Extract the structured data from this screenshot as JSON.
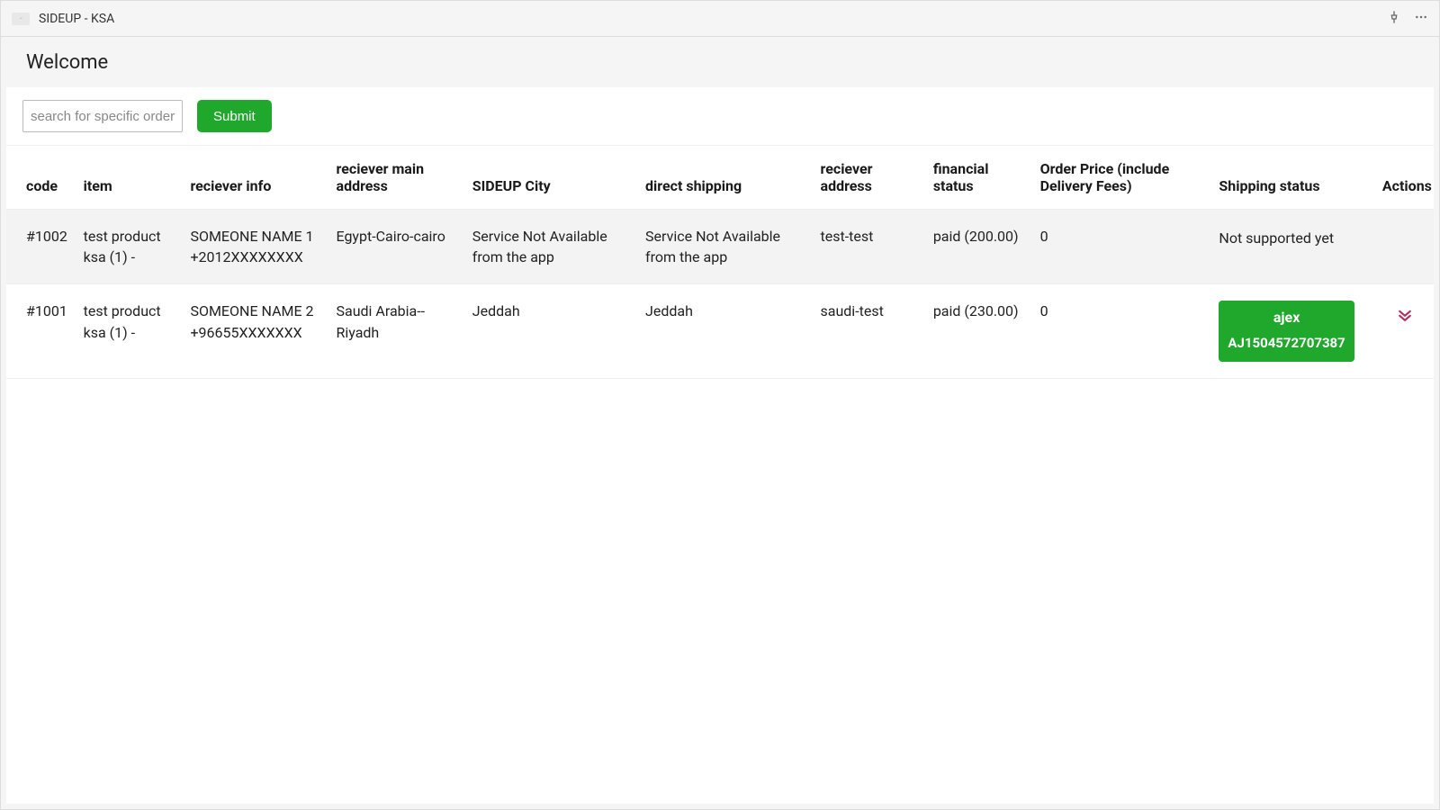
{
  "window": {
    "app_title": "SIDEUP - KSA"
  },
  "header": {
    "title": "Welcome"
  },
  "search": {
    "placeholder": "search for specific order",
    "value": "",
    "submit_label": "Submit"
  },
  "table": {
    "headers": {
      "code": "code",
      "item": "item",
      "reciever_info": "reciever info",
      "reciever_main_address": "reciever main address",
      "sideup_city": "SIDEUP City",
      "direct_shipping": "direct shipping",
      "reciever_address": "reciever address",
      "financial_status": "financial status",
      "order_price": "Order Price (include Delivery Fees)",
      "shipping_status": "Shipping status",
      "actions": "Actions"
    },
    "rows": [
      {
        "code": "#1002",
        "item": "test product ksa (1) -",
        "reciever_info": "SOMEONE NAME 1 +2012XXXXXXXX",
        "reciever_main_address": "Egypt-Cairo-cairo",
        "sideup_city": "Service Not Available from the app",
        "direct_shipping": "Service Not Available from the app",
        "reciever_address": "test-test",
        "financial_status": "paid (200.00)",
        "order_price": "0",
        "shipping_status_type": "text",
        "shipping_status_text": "Not supported yet",
        "has_action": false,
        "shaded": true
      },
      {
        "code": "#1001",
        "item": "test product ksa (1) -",
        "reciever_info": "SOMEONE NAME 2 +96655XXXXXXX",
        "reciever_main_address": "Saudi Arabia--Riyadh",
        "sideup_city": "Jeddah",
        "direct_shipping": "Jeddah",
        "reciever_address": "saudi-test",
        "financial_status": "paid (230.00)",
        "order_price": "0",
        "shipping_status_type": "badge",
        "shipping_badge_line1": "ajex",
        "shipping_badge_line2": "AJ1504572707387",
        "has_action": true,
        "shaded": false
      }
    ]
  }
}
